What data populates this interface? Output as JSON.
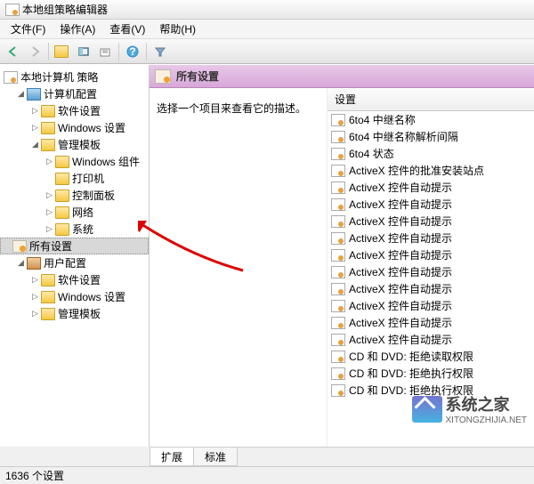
{
  "window": {
    "title": "本地组策略编辑器"
  },
  "menu": {
    "file": "文件(F)",
    "action": "操作(A)",
    "view": "查看(V)",
    "help": "帮助(H)"
  },
  "tree": {
    "root": "本地计算机 策略",
    "computer_config": "计算机配置",
    "software_settings": "软件设置",
    "windows_settings": "Windows 设置",
    "admin_templates": "管理模板",
    "windows_components": "Windows 组件",
    "printers": "打印机",
    "control_panel": "控制面板",
    "network": "网络",
    "system": "系统",
    "all_settings": "所有设置",
    "user_config": "用户配置",
    "user_software": "软件设置",
    "user_windows": "Windows 设置",
    "user_admin": "管理模板"
  },
  "main": {
    "header": "所有设置",
    "description": "选择一个项目来查看它的描述。",
    "column_header": "设置"
  },
  "settings_list": [
    "6to4 中继名称",
    "6to4 中继名称解析间隔",
    "6to4 状态",
    "ActiveX 控件的批准安装站点",
    "ActiveX 控件自动提示",
    "ActiveX 控件自动提示",
    "ActiveX 控件自动提示",
    "ActiveX 控件自动提示",
    "ActiveX 控件自动提示",
    "ActiveX 控件自动提示",
    "ActiveX 控件自动提示",
    "ActiveX 控件自动提示",
    "ActiveX 控件自动提示",
    "ActiveX 控件自动提示",
    "CD 和 DVD: 拒绝读取权限",
    "CD 和 DVD: 拒绝执行权限",
    "CD 和 DVD: 拒绝执行权限"
  ],
  "tabs": {
    "extended": "扩展",
    "standard": "标准"
  },
  "status": "1636 个设置",
  "watermark": {
    "name": "系统之家",
    "url": "XITONGZHIJIA.NET"
  }
}
